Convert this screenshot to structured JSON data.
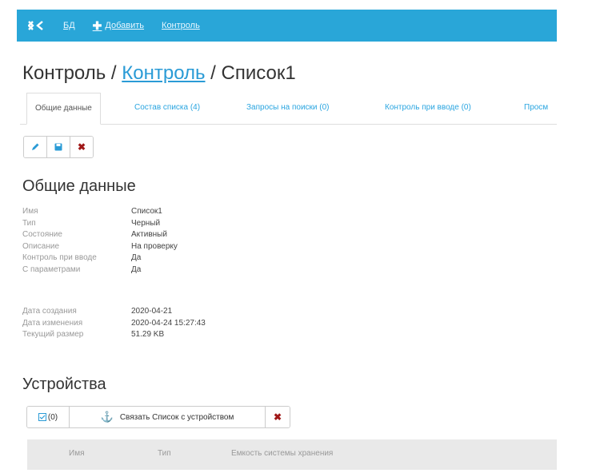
{
  "nav": {
    "db_link": "БД",
    "add_link": "Добавить",
    "control_link": "Контроль"
  },
  "title": {
    "part1": "Контроль",
    "sep1": " / ",
    "link": "Контроль",
    "sep2": " / ",
    "part3": "Список1"
  },
  "tabs": [
    {
      "label": "Общие данные"
    },
    {
      "label": "Состав списка (4)"
    },
    {
      "label": "Запросы на поиски (0)"
    },
    {
      "label": "Контроль при вводе (0)"
    },
    {
      "label": "Просм"
    }
  ],
  "general": {
    "heading": "Общие данные",
    "rows": [
      {
        "label": "Имя",
        "value": "Список1"
      },
      {
        "label": "Тип",
        "value": "Черный"
      },
      {
        "label": "Состояние",
        "value": "Активный"
      },
      {
        "label": "Описание",
        "value": "На проверку"
      },
      {
        "label": "Контроль при вводе",
        "value": "Да"
      },
      {
        "label": "С параметрами",
        "value": "Да"
      }
    ],
    "rows2": [
      {
        "label": "Дата создания",
        "value": "2020-04-21"
      },
      {
        "label": "Дата изменения",
        "value": "2020-04-24 15:27:43"
      },
      {
        "label": "Текущий размер",
        "value": "51.29 KB"
      }
    ]
  },
  "devices": {
    "heading": "Устройства",
    "select_count": "(0)",
    "link_button": "Связать Список с устройством",
    "columns": [
      "Имя",
      "Тип",
      "Емкость системы хранения"
    ]
  },
  "colors": {
    "topbar": "#29a6d8",
    "link": "#2a9bd6",
    "delete": "#a01818"
  }
}
